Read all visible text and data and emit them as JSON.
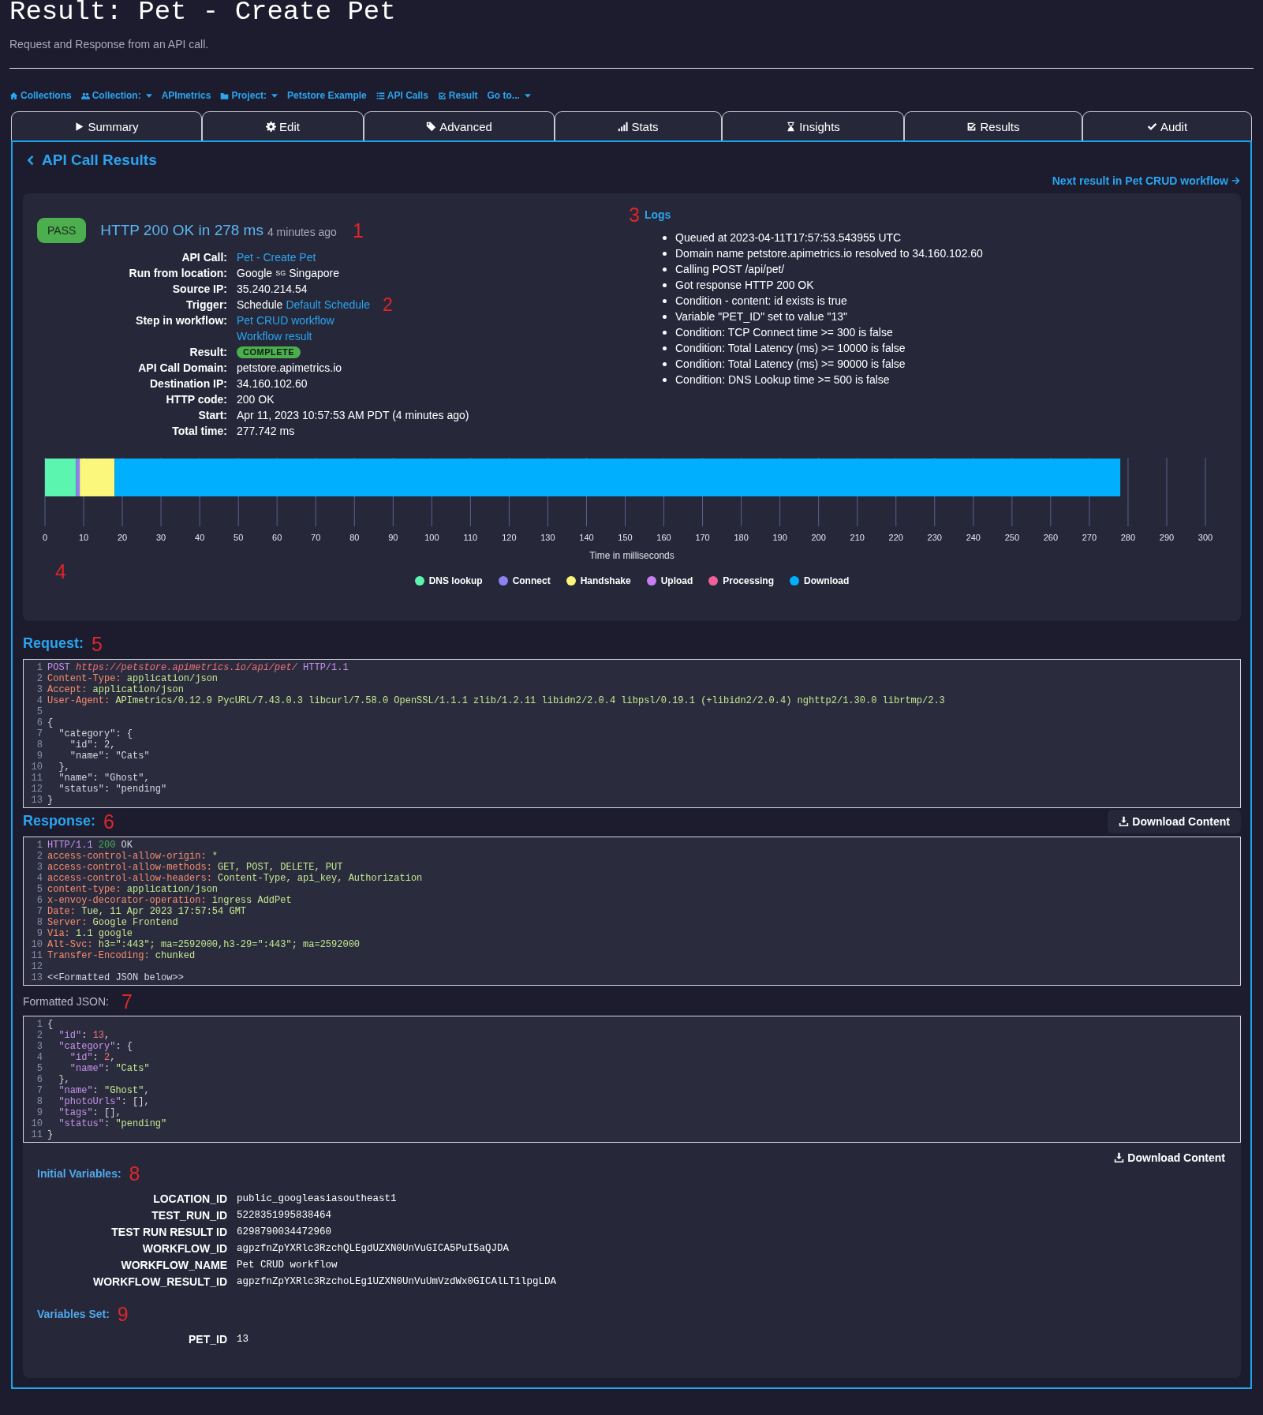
{
  "page": {
    "title": "Result: Pet - Create Pet",
    "subtitle": "Request and Response from an API call."
  },
  "breadcrumb": [
    {
      "kind": "home",
      "label": "Collections",
      "dropdown": false
    },
    {
      "kind": "users",
      "label": "Collection:",
      "dropdown": true
    },
    {
      "kind": "none",
      "label": "APImetrics",
      "dropdown": false
    },
    {
      "kind": "folder",
      "label": "Project:",
      "dropdown": true
    },
    {
      "kind": "none",
      "label": "Petstore Example",
      "dropdown": false
    },
    {
      "kind": "list",
      "label": "API Calls",
      "dropdown": false
    },
    {
      "kind": "checksq",
      "label": "Result",
      "dropdown": false
    },
    {
      "kind": "none",
      "label": "Go to...",
      "dropdown": true
    }
  ],
  "tabs": [
    {
      "kind": "play",
      "label": "Summary"
    },
    {
      "kind": "gear",
      "label": "Edit"
    },
    {
      "kind": "tag",
      "label": "Advanced"
    },
    {
      "kind": "bars",
      "label": "Stats"
    },
    {
      "kind": "hourglass",
      "label": "Insights"
    },
    {
      "kind": "checksq",
      "label": "Results"
    },
    {
      "kind": "check",
      "label": "Audit"
    }
  ],
  "back_link": "API Call Results",
  "next_link": "Next result in Pet CRUD workflow",
  "summary": {
    "status": "PASS",
    "headline": "HTTP 200 OK in 278 ms",
    "age": "4 minutes ago",
    "marker": "1",
    "details": [
      {
        "label": "API Call:",
        "parts": [
          {
            "kind": "link",
            "text": "Pet - Create Pet"
          }
        ]
      },
      {
        "label": "Run from location:",
        "parts": [
          {
            "kind": "text",
            "text": "Google"
          },
          {
            "kind": "small",
            "text": "SG"
          },
          {
            "kind": "text",
            "text": "Singapore"
          }
        ]
      },
      {
        "label": "Source IP:",
        "parts": [
          {
            "kind": "text",
            "text": "35.240.214.54"
          }
        ]
      },
      {
        "label": "Trigger:",
        "parts": [
          {
            "kind": "text",
            "text": "Schedule"
          },
          {
            "kind": "link",
            "text": "Default Schedule"
          },
          {
            "kind": "marker",
            "text": "2"
          }
        ]
      },
      {
        "label": "Step in workflow:",
        "parts": [
          {
            "kind": "link",
            "text": "Pet CRUD workflow"
          }
        ]
      },
      {
        "parts": [
          {
            "kind": "link",
            "text": "Workflow result"
          }
        ]
      },
      {
        "label": "Result:",
        "parts": [
          {
            "kind": "badge",
            "text": "COMPLETE"
          }
        ]
      },
      {
        "label": "API Call Domain:",
        "parts": [
          {
            "kind": "text",
            "text": "petstore.apimetrics.io"
          }
        ]
      },
      {
        "label": "Destination IP:",
        "parts": [
          {
            "kind": "text",
            "text": "34.160.102.60"
          }
        ]
      },
      {
        "label": "HTTP code:",
        "parts": [
          {
            "kind": "text",
            "text": "200 OK"
          }
        ]
      },
      {
        "label": "Start:",
        "parts": [
          {
            "kind": "text",
            "text": "Apr 11, 2023 10:57:53 AM PDT (4 minutes ago)"
          }
        ]
      },
      {
        "label": "Total time:",
        "parts": [
          {
            "kind": "text",
            "text": "277.742 ms"
          }
        ]
      }
    ],
    "logs": {
      "marker": "3",
      "title": "Logs",
      "items": [
        "Queued at 2023-04-11T17:57:53.543955 UTC",
        "Domain name petstore.apimetrics.io resolved to 34.160.102.60",
        "Calling POST /api/pet/",
        "Got response HTTP 200 OK",
        "Condition - content: id exists is true",
        "Variable \"PET_ID\" set to value \"13\"",
        "Condition: TCP Connect time >= 300 is false",
        "Condition: Total Latency (ms) >= 10000 is false",
        "Condition: Total Latency (ms) >= 90000 is false",
        "Condition: DNS Lookup time >= 500 is false"
      ]
    },
    "timeline": {
      "marker": "4",
      "chart_data": {
        "type": "bar",
        "orientation": "horizontal",
        "stacked": true,
        "grid": true,
        "legend": true,
        "xlabel": "Time in milliseconds",
        "xlim": [
          0,
          300
        ],
        "xticks": [
          0,
          10,
          20,
          30,
          40,
          50,
          60,
          70,
          80,
          90,
          100,
          110,
          120,
          130,
          140,
          150,
          160,
          170,
          180,
          190,
          200,
          210,
          220,
          230,
          240,
          250,
          260,
          270,
          280,
          290,
          300
        ],
        "series": [
          {
            "name": "DNS lookup",
            "color": "#5cf5b0",
            "values": [
              8
            ]
          },
          {
            "name": "Connect",
            "color": "#8c82f2",
            "values": [
              1
            ]
          },
          {
            "name": "Handshake",
            "color": "#fbf77c",
            "values": [
              9
            ]
          },
          {
            "name": "Upload",
            "color": "#c77ff0",
            "values": [
              0
            ]
          },
          {
            "name": "Processing",
            "color": "#f0609a",
            "values": [
              0
            ]
          },
          {
            "name": "Download",
            "color": "#00b0ff",
            "values": [
              260
            ]
          }
        ]
      }
    }
  },
  "request": {
    "title": "Request:",
    "marker": "5",
    "lines": [
      {
        "n": "1",
        "segs": [
          {
            "kind": "kw",
            "text": "POST"
          },
          {
            "kind": "url",
            "text": " https://petstore.apimetrics.io/api/pet/"
          },
          {
            "kind": "kw",
            "text": " HTTP/1.1"
          }
        ]
      },
      {
        "n": "2",
        "segs": [
          {
            "kind": "key",
            "text": "Content-Type:"
          },
          {
            "kind": "val",
            "text": " application/json"
          }
        ]
      },
      {
        "n": "3",
        "segs": [
          {
            "kind": "key",
            "text": "Accept:"
          },
          {
            "kind": "val",
            "text": " application/json"
          }
        ]
      },
      {
        "n": "4",
        "segs": [
          {
            "kind": "key",
            "text": "User-Agent:"
          },
          {
            "kind": "val",
            "text": " APImetrics/0.12.9 PycURL/7.43.0.3 libcurl/7.58.0 OpenSSL/1.1.1 zlib/1.2.11 libidn2/2.0.4 libpsl/0.19.1 (+libidn2/2.0.4) nghttp2/1.30.0 librtmp/2.3"
          }
        ]
      },
      {
        "n": "5"
      },
      {
        "n": "6",
        "segs": [
          {
            "kind": "plain",
            "text": "{"
          }
        ]
      },
      {
        "n": "7",
        "segs": [
          {
            "kind": "plain",
            "text": "  \"category\": {"
          }
        ]
      },
      {
        "n": "8",
        "segs": [
          {
            "kind": "plain",
            "text": "    \"id\": 2,"
          }
        ]
      },
      {
        "n": "9",
        "segs": [
          {
            "kind": "plain",
            "text": "    \"name\": \"Cats\""
          }
        ]
      },
      {
        "n": "10",
        "segs": [
          {
            "kind": "plain",
            "text": "  },"
          }
        ]
      },
      {
        "n": "11",
        "segs": [
          {
            "kind": "plain",
            "text": "  \"name\": \"Ghost\","
          }
        ]
      },
      {
        "n": "12",
        "segs": [
          {
            "kind": "plain",
            "text": "  \"status\": \"pending\""
          }
        ]
      },
      {
        "n": "13",
        "segs": [
          {
            "kind": "plain",
            "text": "}"
          }
        ]
      }
    ]
  },
  "response": {
    "title": "Response:",
    "marker": "6",
    "download": "Download Content",
    "lines": [
      {
        "n": "1",
        "segs": [
          {
            "kind": "kw",
            "text": "HTTP/1.1"
          },
          {
            "kind": "status",
            "text": " 200"
          },
          {
            "kind": "plain",
            "text": " OK"
          }
        ]
      },
      {
        "n": "2",
        "segs": [
          {
            "kind": "key",
            "text": "access-control-allow-origin:"
          },
          {
            "kind": "val",
            "text": " *"
          }
        ]
      },
      {
        "n": "3",
        "segs": [
          {
            "kind": "key",
            "text": "access-control-allow-methods:"
          },
          {
            "kind": "val",
            "text": " GET, POST, DELETE, PUT"
          }
        ]
      },
      {
        "n": "4",
        "segs": [
          {
            "kind": "key",
            "text": "access-control-allow-headers:"
          },
          {
            "kind": "val",
            "text": " Content-Type, api_key, Authorization"
          }
        ]
      },
      {
        "n": "5",
        "segs": [
          {
            "kind": "key",
            "text": "content-type:"
          },
          {
            "kind": "val",
            "text": " application/json"
          }
        ]
      },
      {
        "n": "6",
        "segs": [
          {
            "kind": "key",
            "text": "x-envoy-decorator-operation:"
          },
          {
            "kind": "val",
            "text": " ingress AddPet"
          }
        ]
      },
      {
        "n": "7",
        "segs": [
          {
            "kind": "key",
            "text": "Date:"
          },
          {
            "kind": "val",
            "text": " Tue, 11 Apr 2023 17:57:54 GMT"
          }
        ]
      },
      {
        "n": "8",
        "segs": [
          {
            "kind": "key",
            "text": "Server:"
          },
          {
            "kind": "val",
            "text": " Google Frontend"
          }
        ]
      },
      {
        "n": "9",
        "segs": [
          {
            "kind": "key",
            "text": "Via:"
          },
          {
            "kind": "val",
            "text": " 1.1 google"
          }
        ]
      },
      {
        "n": "10",
        "segs": [
          {
            "kind": "key",
            "text": "Alt-Svc:"
          },
          {
            "kind": "val",
            "text": " h3=\":443\"; ma=2592000,h3-29=\":443\"; ma=2592000"
          }
        ]
      },
      {
        "n": "11",
        "segs": [
          {
            "kind": "key",
            "text": "Transfer-Encoding:"
          },
          {
            "kind": "val",
            "text": " chunked"
          }
        ]
      },
      {
        "n": "12"
      },
      {
        "n": "13",
        "segs": [
          {
            "kind": "plain",
            "text": "<<Formatted JSON below>>"
          }
        ]
      }
    ]
  },
  "formatted_json": {
    "title": "Formatted JSON:",
    "marker": "7",
    "lines": [
      {
        "n": "1",
        "segs": [
          {
            "kind": "plain",
            "text": "{"
          }
        ]
      },
      {
        "n": "2",
        "segs": [
          {
            "kind": "prop",
            "text": "  \"id\""
          },
          {
            "kind": "plain",
            "text": ": "
          },
          {
            "kind": "num",
            "text": "13"
          },
          {
            "kind": "plain",
            "text": ","
          }
        ]
      },
      {
        "n": "3",
        "segs": [
          {
            "kind": "prop",
            "text": "  \"category\""
          },
          {
            "kind": "plain",
            "text": ": {"
          }
        ]
      },
      {
        "n": "4",
        "segs": [
          {
            "kind": "prop",
            "text": "    \"id\""
          },
          {
            "kind": "plain",
            "text": ": "
          },
          {
            "kind": "num",
            "text": "2"
          },
          {
            "kind": "plain",
            "text": ","
          }
        ]
      },
      {
        "n": "5",
        "segs": [
          {
            "kind": "prop",
            "text": "    \"name\""
          },
          {
            "kind": "plain",
            "text": ": "
          },
          {
            "kind": "str",
            "text": "\"Cats\""
          }
        ]
      },
      {
        "n": "6",
        "segs": [
          {
            "kind": "plain",
            "text": "  },"
          }
        ]
      },
      {
        "n": "7",
        "segs": [
          {
            "kind": "prop",
            "text": "  \"name\""
          },
          {
            "kind": "plain",
            "text": ": "
          },
          {
            "kind": "str",
            "text": "\"Ghost\""
          },
          {
            "kind": "plain",
            "text": ","
          }
        ]
      },
      {
        "n": "8",
        "segs": [
          {
            "kind": "prop",
            "text": "  \"photoUrls\""
          },
          {
            "kind": "plain",
            "text": ": [],"
          }
        ]
      },
      {
        "n": "9",
        "segs": [
          {
            "kind": "prop",
            "text": "  \"tags\""
          },
          {
            "kind": "plain",
            "text": ": [],"
          }
        ]
      },
      {
        "n": "10",
        "segs": [
          {
            "kind": "prop",
            "text": "  \"status\""
          },
          {
            "kind": "plain",
            "text": ": "
          },
          {
            "kind": "str",
            "text": "\"pending\""
          }
        ]
      },
      {
        "n": "11",
        "segs": [
          {
            "kind": "plain",
            "text": "}"
          }
        ]
      }
    ]
  },
  "variables": {
    "download": "Download Content",
    "initial": {
      "title": "Initial Variables:",
      "marker": "8",
      "rows": [
        {
          "name": "LOCATION_ID",
          "value": "public_googleasiasoutheast1"
        },
        {
          "name": "TEST_RUN_ID",
          "value": "5228351995838464"
        },
        {
          "name": "TEST RUN RESULT ID",
          "value": "6298790034472960"
        },
        {
          "name": "WORKFLOW_ID",
          "value": "agpzfnZpYXRlc3RzchQLEgdUZXN0UnVuGICA5PuI5aQJDA"
        },
        {
          "name": "WORKFLOW_NAME",
          "value": "Pet CRUD workflow"
        },
        {
          "name": "WORKFLOW_RESULT_ID",
          "value": "agpzfnZpYXRlc3RzchoLEg1UZXN0UnVuUmVzdWx0GICAlLT1lpgLDA"
        }
      ]
    },
    "set": {
      "title": "Variables Set:",
      "marker": "9",
      "rows": [
        {
          "name": "PET_ID",
          "value": "13"
        }
      ]
    }
  }
}
